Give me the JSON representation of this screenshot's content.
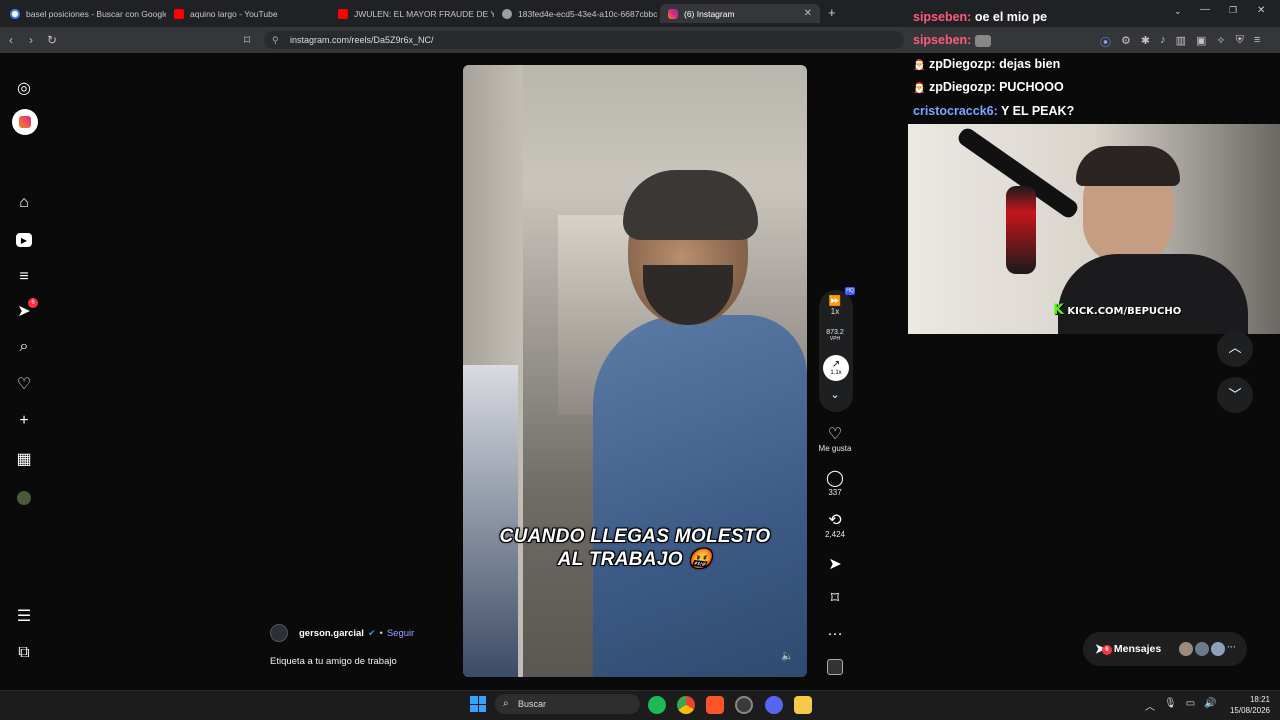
{
  "browser": {
    "tabs": [
      {
        "title": "basel posiciones - Buscar con Google",
        "color": "#4285f4"
      },
      {
        "title": "aquino largo - YouTube",
        "color": "#ff0000"
      },
      {
        "title": "JWULEN: EL MAYOR FRAUDE DE YOU",
        "color": "#ff0000"
      },
      {
        "title": "183fed4e-ecd5-43e4-a10c-6687cbbc",
        "color": "#9aa0a6"
      },
      {
        "title": "(6) Instagram",
        "color": "#e1306c"
      }
    ],
    "url": "instagram.com/reels/Da5Z9r6x_NC/"
  },
  "sidebar": {
    "items": [
      {
        "name": "instagram-logo-icon",
        "glyph": "◎"
      },
      {
        "name": "app-install-icon",
        "glyph": "⬇"
      },
      {
        "name": "home-icon",
        "glyph": "⌂"
      },
      {
        "name": "reels-icon",
        "glyph": "▶"
      },
      {
        "name": "feed-icon",
        "glyph": "≡"
      },
      {
        "name": "messages-icon",
        "glyph": "➤",
        "badge": "6"
      },
      {
        "name": "search-icon",
        "glyph": "⌕"
      },
      {
        "name": "notifications-icon",
        "glyph": "♡"
      },
      {
        "name": "create-icon",
        "glyph": "+"
      },
      {
        "name": "dashboard-icon",
        "glyph": "▦"
      },
      {
        "name": "profile-avatar-icon",
        "glyph": "●"
      },
      {
        "name": "more-menu-icon",
        "glyph": "☰"
      },
      {
        "name": "also-from-meta-icon",
        "glyph": "⧉"
      }
    ]
  },
  "reel": {
    "caption_overlay_line1": "CUANDO LLEGAS MOLESTO",
    "caption_overlay_line2": "AL TRABAJO 🤬",
    "author": "gerson.garcial",
    "follow_label": "Seguir",
    "separator": "•",
    "description": "Etiqueta a tu amigo de trabajo"
  },
  "actions": {
    "speed": "1x",
    "vph_value": "873.2",
    "vph_label": "VPH",
    "trend_value": "1.1x",
    "like_label": "Me gusta",
    "comments": "337",
    "reposts": "2,424",
    "hq_badge": "HQ"
  },
  "chat": [
    {
      "user": "sipseben:",
      "msg": "oe el mio pe",
      "color": "#ff5a7a"
    },
    {
      "user": "sipseben:",
      "msg": "",
      "color": "#ff5a7a"
    },
    {
      "user": "zpDiegozp:",
      "msg": "dejas bien",
      "color": "#ffffff"
    },
    {
      "user": "zpDiegozp:",
      "msg": "PUCHOOO",
      "color": "#ffffff"
    },
    {
      "user": "cristocracck6:",
      "msg": "Y EL PEAK?",
      "color": "#7aa8ff"
    }
  ],
  "stream": {
    "watermark": "KICK.COM/BEPUCHO"
  },
  "messages_button": {
    "label": "Mensajes",
    "badge": "6"
  },
  "taskbar": {
    "search_placeholder": "Buscar",
    "time": "18:21",
    "date": "15/08/2026"
  }
}
